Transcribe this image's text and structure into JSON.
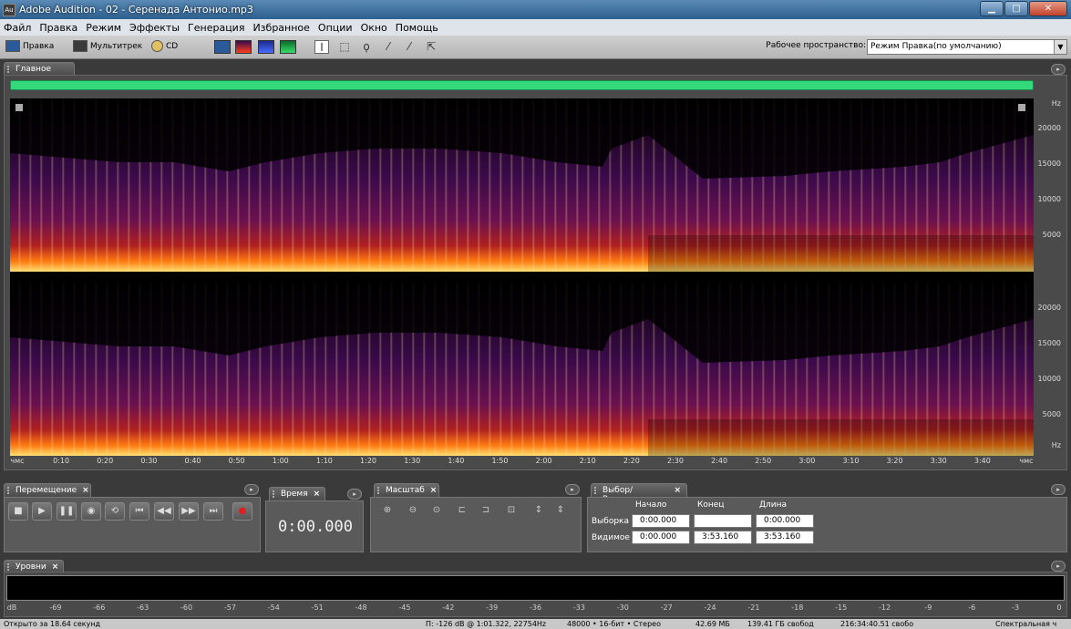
{
  "window": {
    "title": "Adobe Audition - 02 - Серенада Антонио.mp3",
    "app_icon": "Au",
    "controls": {
      "minimize": "▁",
      "maximize": "□",
      "close": "✕"
    }
  },
  "menu": [
    "Файл",
    "Правка",
    "Режим",
    "Эффекты",
    "Генерация",
    "Избранное",
    "Опции",
    "Окно",
    "Помощь"
  ],
  "toolbar": {
    "modes": [
      "Правка",
      "Мультитрек",
      "CD"
    ],
    "workspace_label": "Рабочее пространство:",
    "workspace_value": "Режим Правка(по умолчанию)"
  },
  "main_panel": {
    "tab": "Главное",
    "overview_color": "#34d97c",
    "freq_unit": "Hz",
    "freq_ticks": [
      "20000",
      "15000",
      "10000",
      "5000"
    ],
    "time_ticks": [
      "чмс",
      "0:10",
      "0:20",
      "0:30",
      "0:40",
      "0:50",
      "1:00",
      "1:10",
      "1:20",
      "1:30",
      "1:40",
      "1:50",
      "2:00",
      "2:10",
      "2:20",
      "2:30",
      "2:40",
      "2:50",
      "3:00",
      "3:10",
      "3:20",
      "3:30",
      "3:40",
      "чмс"
    ]
  },
  "transport": {
    "tab": "Перемещение",
    "buttons": [
      "■",
      "▶",
      "❚❚",
      "◉",
      "⟲",
      "⏮",
      "◀◀",
      "▶▶",
      "⏭",
      "●"
    ]
  },
  "time_panel": {
    "tab": "Время",
    "value": "0:00.000"
  },
  "zoom_panel": {
    "tab": "Масштаб"
  },
  "selection_panel": {
    "tab": "Выбор/Видимое",
    "headers": [
      "Начало",
      "Конец",
      "Длина"
    ],
    "rows": [
      {
        "label": "Выборка",
        "start": "0:00.000",
        "end": "",
        "length": "0:00.000"
      },
      {
        "label": "Видимое",
        "start": "0:00.000",
        "end": "3:53.160",
        "length": "3:53.160"
      }
    ]
  },
  "levels_panel": {
    "tab": "Уровни",
    "scale": [
      "dB",
      "-69",
      "-66",
      "-63",
      "-60",
      "-57",
      "-54",
      "-51",
      "-48",
      "-45",
      "-42",
      "-39",
      "-36",
      "-33",
      "-30",
      "-27",
      "-24",
      "-21",
      "-18",
      "-15",
      "-12",
      "-9",
      "-6",
      "-3",
      "0"
    ]
  },
  "status": {
    "opened": "Открыто за 18.64 секунд",
    "cursor": "П: -126 dB @  1:01.322, 22754Hz",
    "format": "48000 • 16-бит • Стерео",
    "size": "42.69 МБ",
    "free": "139.41 ГБ свобод",
    "free_time": "216:34:40.51 свобо",
    "view": "Спектральная ч"
  }
}
